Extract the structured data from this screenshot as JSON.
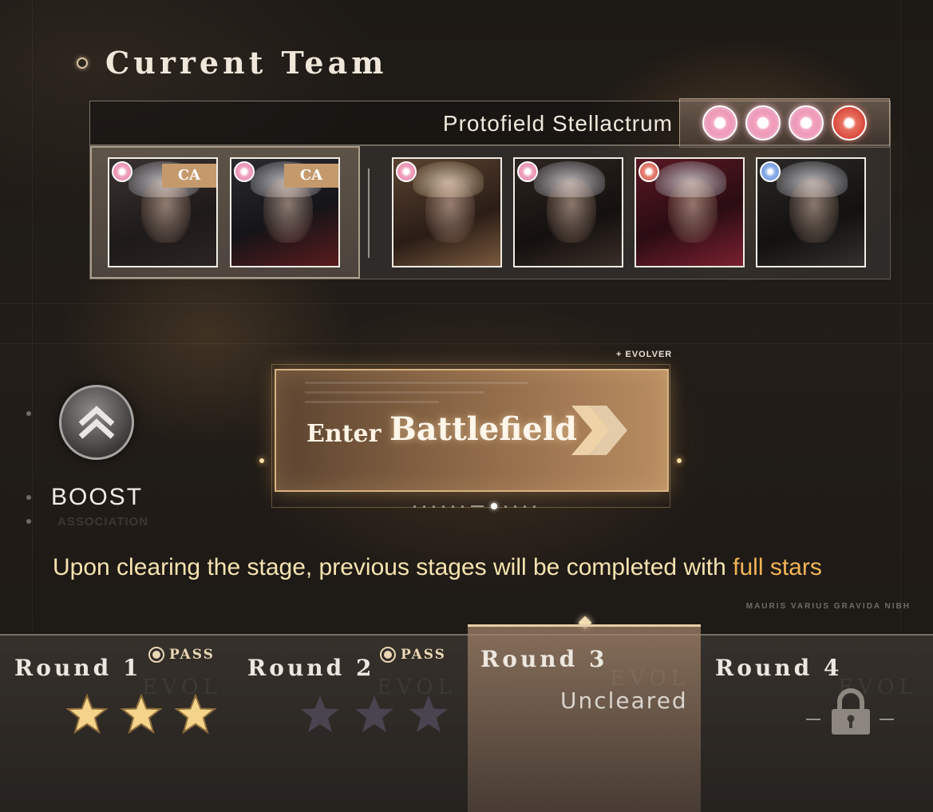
{
  "header": {
    "title": "Current Team"
  },
  "team": {
    "name": "Protofield Stellactrum",
    "orbs": [
      "pink",
      "pink",
      "pink",
      "red"
    ],
    "support": [
      {
        "badge": "pink",
        "tag": "CA"
      },
      {
        "badge": "pink",
        "tag": "CA"
      }
    ],
    "members": [
      {
        "badge": "pink"
      },
      {
        "badge": "pink"
      },
      {
        "badge": "red"
      },
      {
        "badge": "blue"
      }
    ]
  },
  "boost": {
    "label": "BOOST",
    "sublabel": "ASSOCIATION"
  },
  "battle": {
    "enter_small": "Enter",
    "enter_big": "Battlefield",
    "tag": "+ EVOLVER"
  },
  "notice": {
    "text": "Upon clearing the stage, previous stages will be completed with ",
    "highlight": "full stars"
  },
  "watermark": "MAURIS VARIUS GRAVIDA NIBH",
  "rounds": [
    {
      "title": "Round 1",
      "status": "PASS",
      "stars": 3,
      "ghost": "EVOL"
    },
    {
      "title": "Round 2",
      "status": "PASS",
      "stars": 0,
      "ghost": "EVOL"
    },
    {
      "title": "Round 3",
      "status": "Uncleared",
      "ghost": "EVOL"
    },
    {
      "title": "Round 4",
      "status": "locked",
      "ghost": "EVOL"
    }
  ],
  "colors": {
    "accent_gold": "#f2b457",
    "star_gold": "#f3d48a",
    "star_empty": "#4a4350",
    "panel_border": "#d8b382"
  }
}
